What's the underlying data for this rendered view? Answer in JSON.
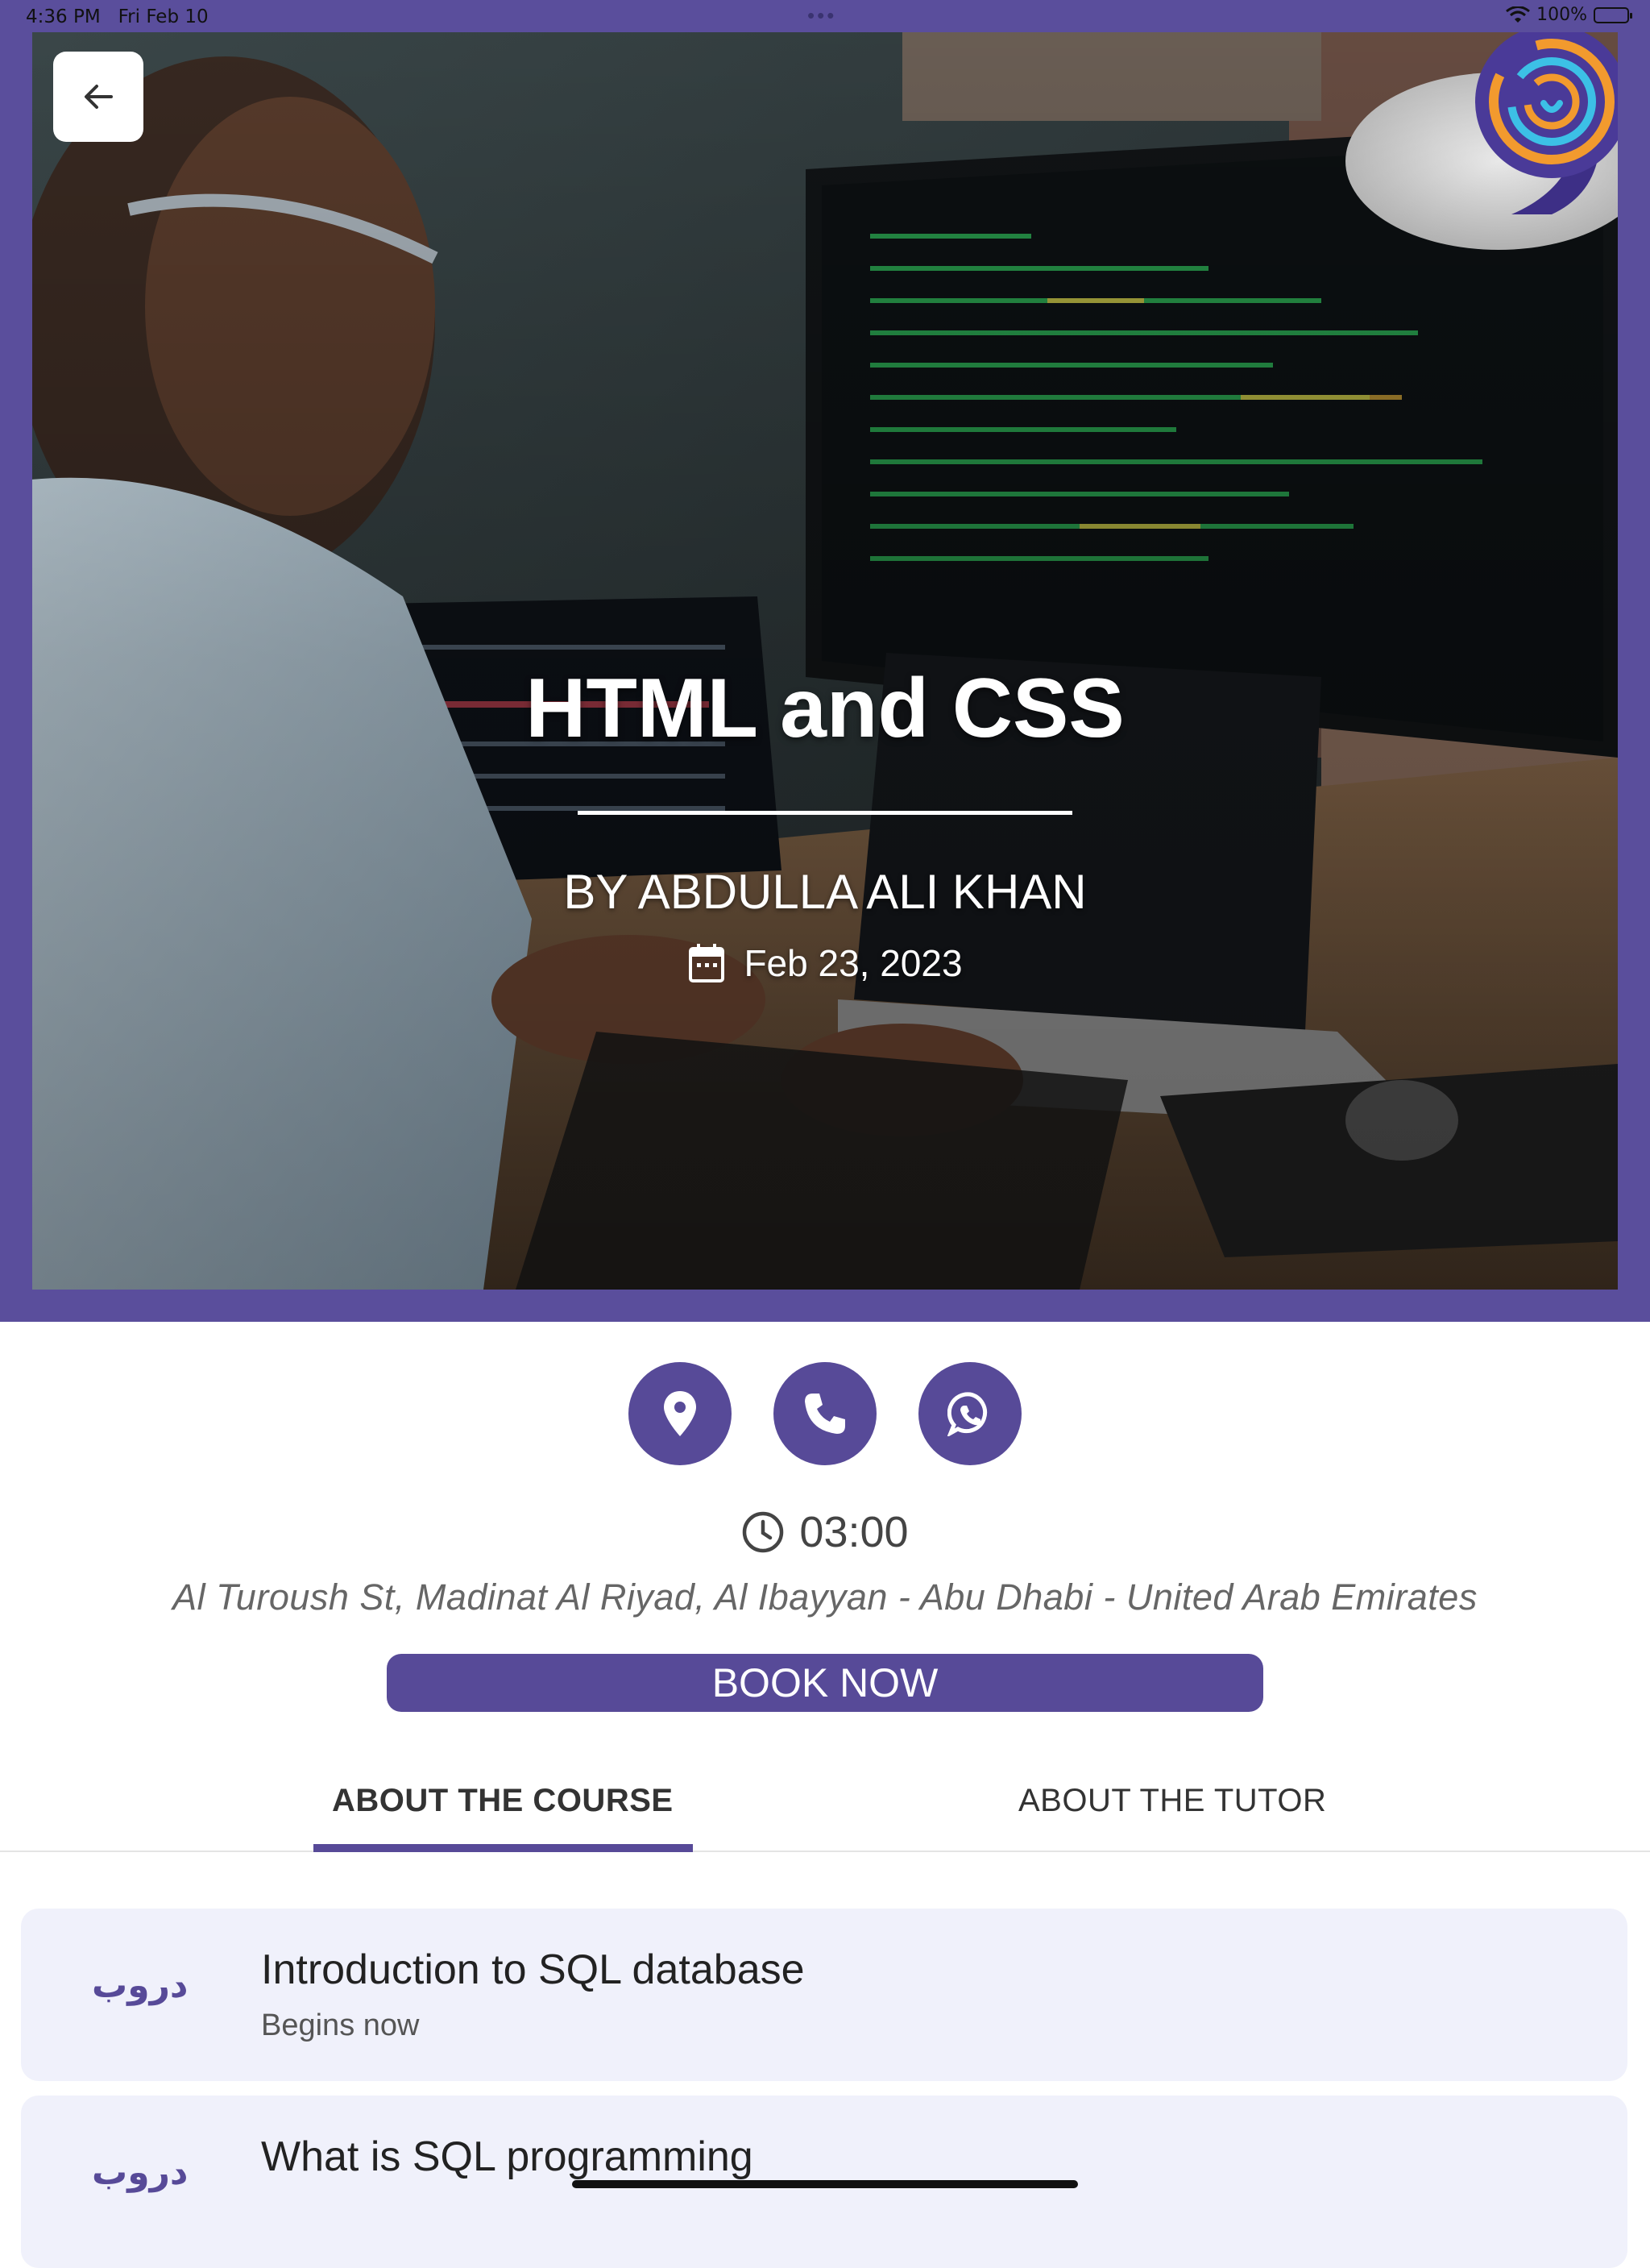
{
  "status_bar": {
    "time": "4:36 PM",
    "date": "Fri Feb 10",
    "battery": "100%",
    "battery_level": 1.0,
    "wifi_icon": "wifi-icon"
  },
  "hero": {
    "title": "HTML and CSS",
    "author": "BY ABDULLA ALI KHAN",
    "date": "Feb 23, 2023",
    "back_icon": "arrow-left-icon",
    "calendar_icon": "calendar-icon",
    "logo": "brand-logo"
  },
  "actions": [
    {
      "name": "location",
      "icon": "map-pin-icon"
    },
    {
      "name": "call",
      "icon": "phone-icon"
    },
    {
      "name": "whatsapp",
      "icon": "whatsapp-icon"
    }
  ],
  "details": {
    "duration": "03:00",
    "clock_icon": "clock-icon",
    "address": "Al Turoush St, Madinat Al Riyad, Al  Ibayyan - Abu Dhabi - United Arab Emirates"
  },
  "book_button": "BOOK NOW",
  "tabs": [
    {
      "label": "ABOUT THE COURSE",
      "active": true
    },
    {
      "label": "ABOUT THE TUTOR",
      "active": false
    }
  ],
  "lessons": [
    {
      "logo_text": "دروب",
      "title": "Introduction to SQL database",
      "subtitle": "Begins now"
    },
    {
      "logo_text": "دروب",
      "title": "What is SQL programming",
      "subtitle": ""
    }
  ],
  "colors": {
    "brand": "#574a98",
    "frame": "#5a4e9c",
    "card_bg": "#f0f1fb",
    "logo_orange": "#f29a2e",
    "logo_cyan": "#3cc0e6"
  }
}
